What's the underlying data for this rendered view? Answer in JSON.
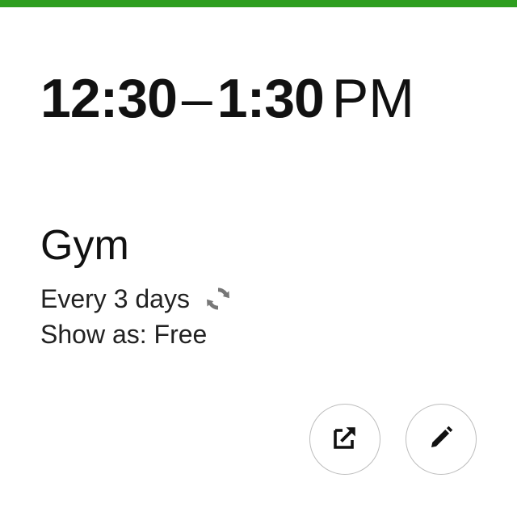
{
  "event": {
    "time_start": "12:30",
    "time_dash": "–",
    "time_end": "1:30",
    "time_ampm": "PM",
    "title": "Gym",
    "recurrence": "Every 3 days",
    "show_as": "Show as: Free"
  },
  "icons": {
    "recurrence": "repeat-icon",
    "open": "open-external-icon",
    "edit": "pencil-icon"
  },
  "colors": {
    "accent_bar": "#2e9e1f",
    "text": "#111111",
    "icon_gray": "#777777",
    "button_border": "#bdbdbd"
  }
}
